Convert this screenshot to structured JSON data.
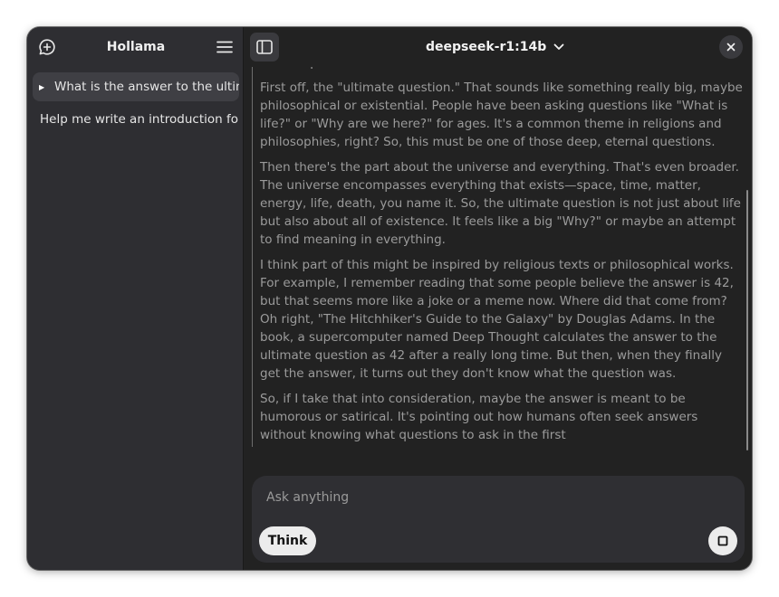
{
  "sidebar": {
    "title": "Hollama",
    "icons": {
      "new_chat": "new-chat-icon",
      "menu": "hamburger-menu-icon"
    },
    "chats": [
      {
        "label": "What is the answer to the ultimate question of life, the universe, and everything?",
        "active": true
      },
      {
        "label": "Help me write an introduction for a blog post",
        "active": false
      }
    ]
  },
  "header": {
    "model": "deepseek-r1:14b",
    "icons": {
      "sidebar_toggle": "sidebar-toggle-icon",
      "model_dropdown": "chevron-down-icon",
      "close": "close-icon"
    }
  },
  "thinking": {
    "partial_top": "the components.",
    "paragraphs": [
      "First off, the \"ultimate question.\" That sounds like something really big, maybe philosophical or existential. People have been asking questions like \"What is life?\" or \"Why are we here?\" for ages. It's a common theme in religions and philosophies, right? So, this must be one of those deep, eternal questions.",
      "Then there's the part about the universe and everything. That's even broader. The universe encompasses everything that exists—space, time, matter, energy, life, death, you name it. So, the ultimate question is not just about life but also about all of existence. It feels like a big \"Why?\" or maybe an attempt to find meaning in everything.",
      "I think part of this might be inspired by religious texts or philosophical works. For example, I remember reading that some people believe the answer is 42, but that seems more like a joke or a meme now. Where did that come from? Oh right, \"The Hitchhiker's Guide to the Galaxy\" by Douglas Adams. In the book, a supercomputer named Deep Thought calculates the answer to the ultimate question as 42 after a really long time. But then, when they finally get the answer, it turns out they don't know what the question was.",
      "So, if I take that into consideration, maybe the answer is meant to be humorous or satirical. It's pointing out how humans often seek answers without knowing what questions to ask in the first"
    ]
  },
  "composer": {
    "placeholder": "Ask anything",
    "think_label": "Think",
    "stop_icon": "stop-icon"
  },
  "colors": {
    "window_bg": "#222222",
    "sidebar_bg": "#2e2e32",
    "active_item_bg": "#3f3f44",
    "thinking_text": "#9b9b9b",
    "button_light": "#ececec"
  }
}
